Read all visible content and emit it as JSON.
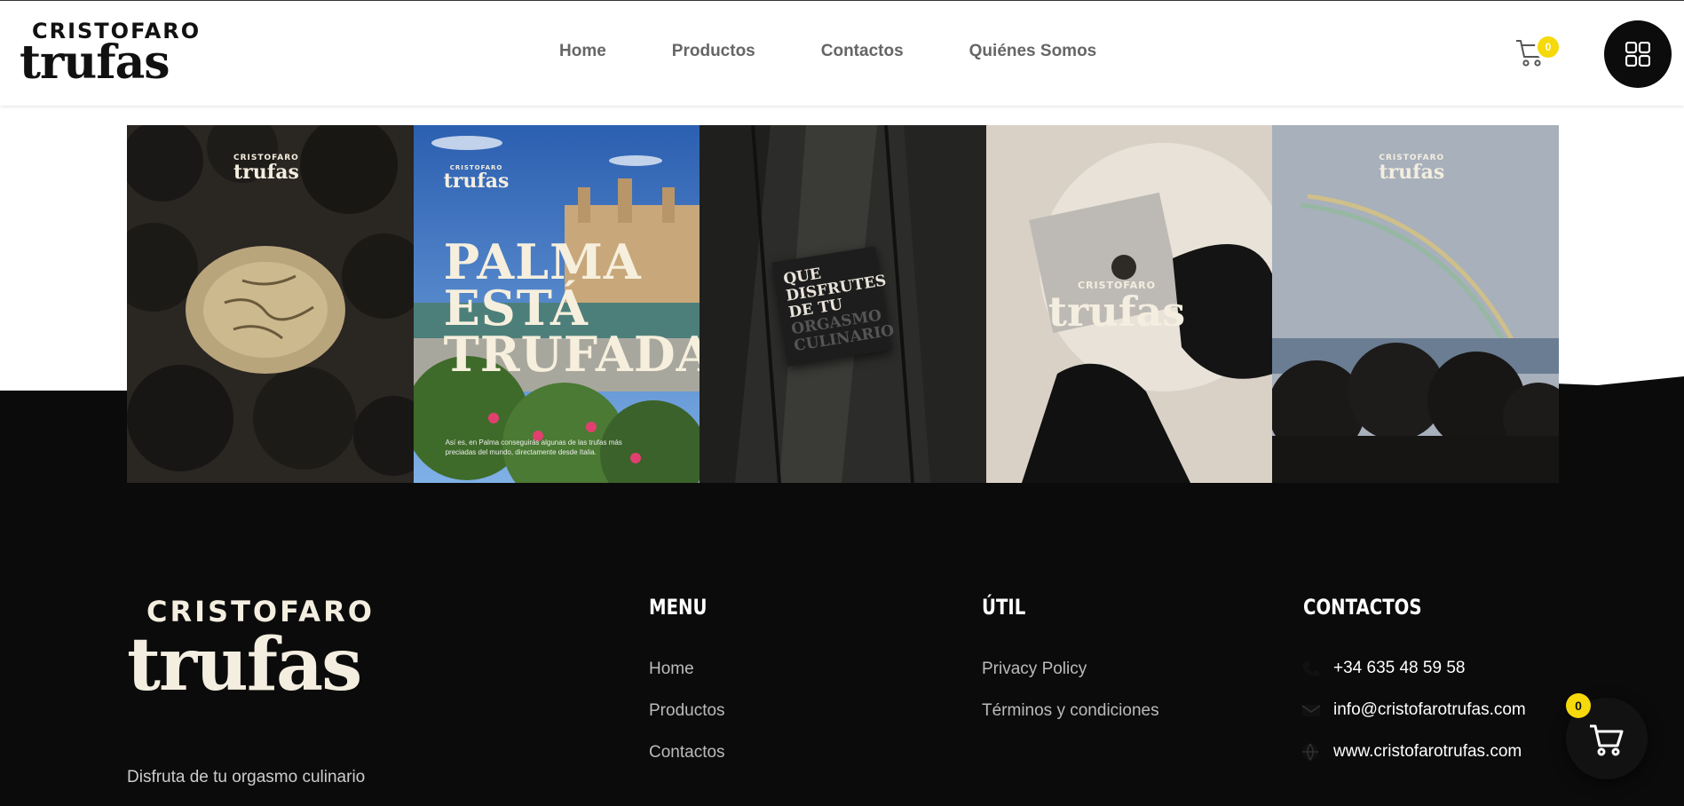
{
  "brand": {
    "top": "CRISTOFARO",
    "main": "trufas"
  },
  "nav": [
    {
      "label": "Home"
    },
    {
      "label": "Productos"
    },
    {
      "label": "Contactos"
    },
    {
      "label": "Quiénes Somos"
    }
  ],
  "cart": {
    "count": "0"
  },
  "gallery": {
    "palma_headline": [
      "PALMA",
      "ESTÁ",
      "TRUFADA."
    ],
    "palma_caption": "Así es, en Palma conseguirás algunas de las trufas más preciadas del mundo, directamente desde Italia.",
    "card_lines_light": [
      "QUE",
      "DISFRUTES",
      "DE TU"
    ],
    "card_lines_dark": [
      "ORGASMO",
      "CULINARIO"
    ]
  },
  "footer": {
    "tagline": "Disfruta de tu orgasmo culinario",
    "menu": {
      "title": "MENU",
      "links": [
        "Home",
        "Productos",
        "Contactos"
      ]
    },
    "util": {
      "title": "ÚTIL",
      "links": [
        "Privacy Policy",
        "Términos y condiciones"
      ]
    },
    "contacts": {
      "title": "CONTACTOS",
      "items": [
        {
          "icon": "phone-icon",
          "text": "+34 635 48 59 58"
        },
        {
          "icon": "envelope-icon",
          "text": "info@cristofarotrufas.com"
        },
        {
          "icon": "globe-icon",
          "text": "www.cristofarotrufas.com"
        }
      ]
    }
  },
  "floating_cart": {
    "count": "0"
  },
  "colors": {
    "accent": "#f5d90a",
    "dark": "#0b0b0b",
    "cream": "#f4eee0"
  }
}
